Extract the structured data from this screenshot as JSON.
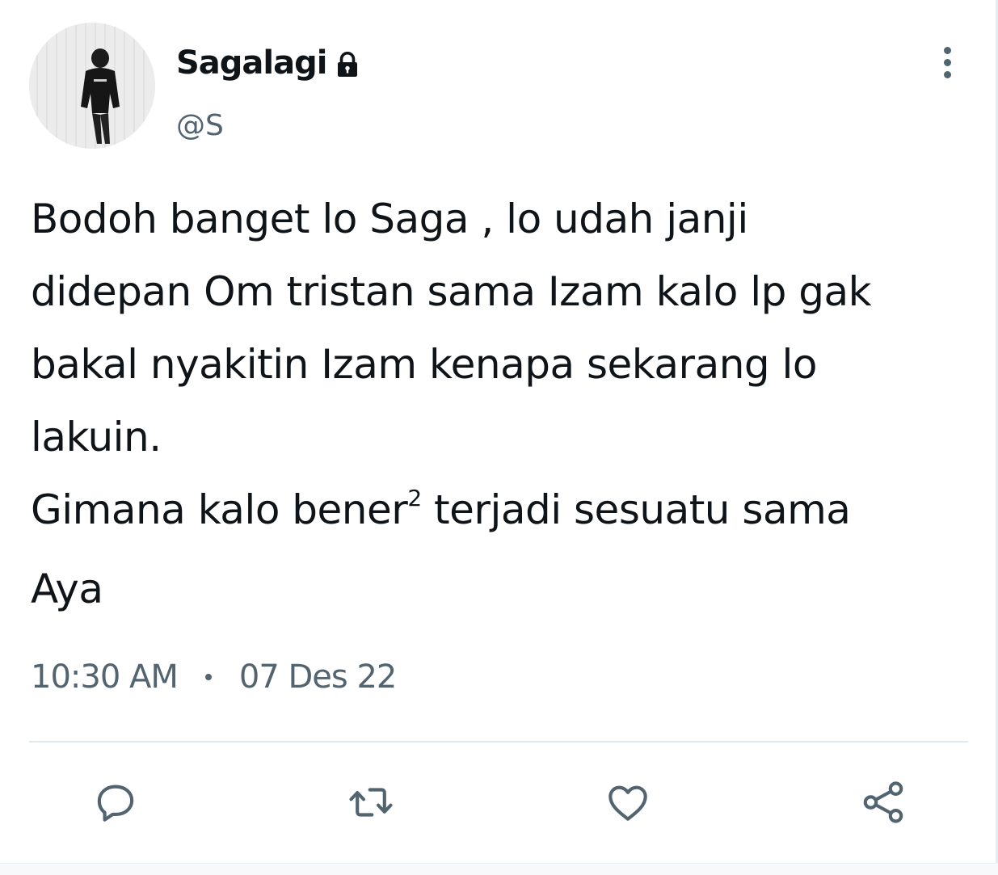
{
  "tweet": {
    "author": {
      "display_name": "Sagalagi",
      "handle": "@S",
      "protected": true,
      "avatar_icon": "profile-photo"
    },
    "text_lines": [
      {
        "text": "Bodoh banget lo Saga , lo udah janji"
      },
      {
        "text": "didepan Om tristan sama Izam kalo lp gak"
      },
      {
        "text": "bakal nyakitin Izam kenapa sekarang lo"
      },
      {
        "text": "lakuin."
      },
      {
        "text_before_sup": "Gimana kalo bener",
        "sup": "2",
        "text_after_sup": " terjadi sesuatu sama"
      },
      {
        "text": "Aya"
      }
    ],
    "time": "10:30 AM",
    "date": "07 Des 22"
  },
  "actions": {
    "reply_icon": "reply-icon",
    "retweet_icon": "retweet-icon",
    "like_icon": "heart-icon",
    "share_icon": "share-icon"
  },
  "colors": {
    "text_primary": "#0f1419",
    "text_secondary": "#536471",
    "divider": "#e1e8ed"
  }
}
